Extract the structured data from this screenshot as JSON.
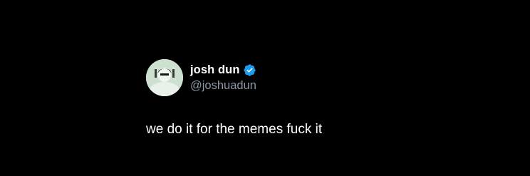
{
  "tweet": {
    "author": {
      "display_name": "josh dun",
      "handle": "@joshuadun",
      "verified": true,
      "avatar_icon": "profile-avatar"
    },
    "text": "we do it for the memes fuck it"
  },
  "colors": {
    "background": "#000000",
    "text": "#ffffff",
    "handle": "#8b98a5",
    "verified_badge": "#1d9bf0"
  }
}
